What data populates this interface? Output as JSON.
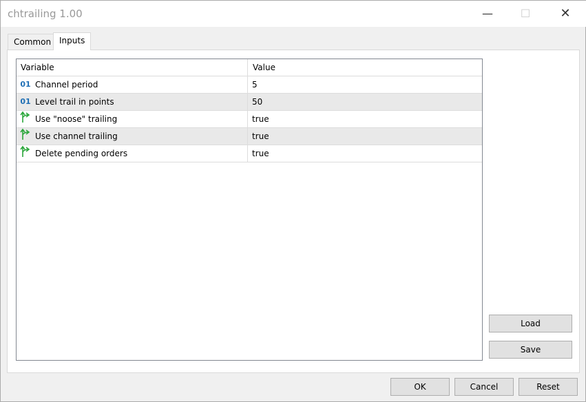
{
  "window": {
    "title": "chtrailing 1.00"
  },
  "tabs": [
    {
      "label": "Common"
    },
    {
      "label": "Inputs"
    }
  ],
  "table": {
    "headers": {
      "variable": "Variable",
      "value": "Value"
    },
    "rows": [
      {
        "type": "int",
        "icon": "01",
        "variable": "Channel period",
        "value": "5"
      },
      {
        "type": "bool",
        "variable": "Level trail in points",
        "value": "50",
        "icon": "01"
      },
      {
        "type": "bool",
        "variable": "Use \"noose\" trailing",
        "value": "true"
      },
      {
        "type": "bool",
        "variable": "Use channel trailing",
        "value": "true"
      },
      {
        "type": "bool",
        "variable": "Delete pending orders",
        "value": "true"
      }
    ]
  },
  "buttons": {
    "load": "Load",
    "save": "Save",
    "ok": "OK",
    "cancel": "Cancel",
    "reset": "Reset"
  }
}
